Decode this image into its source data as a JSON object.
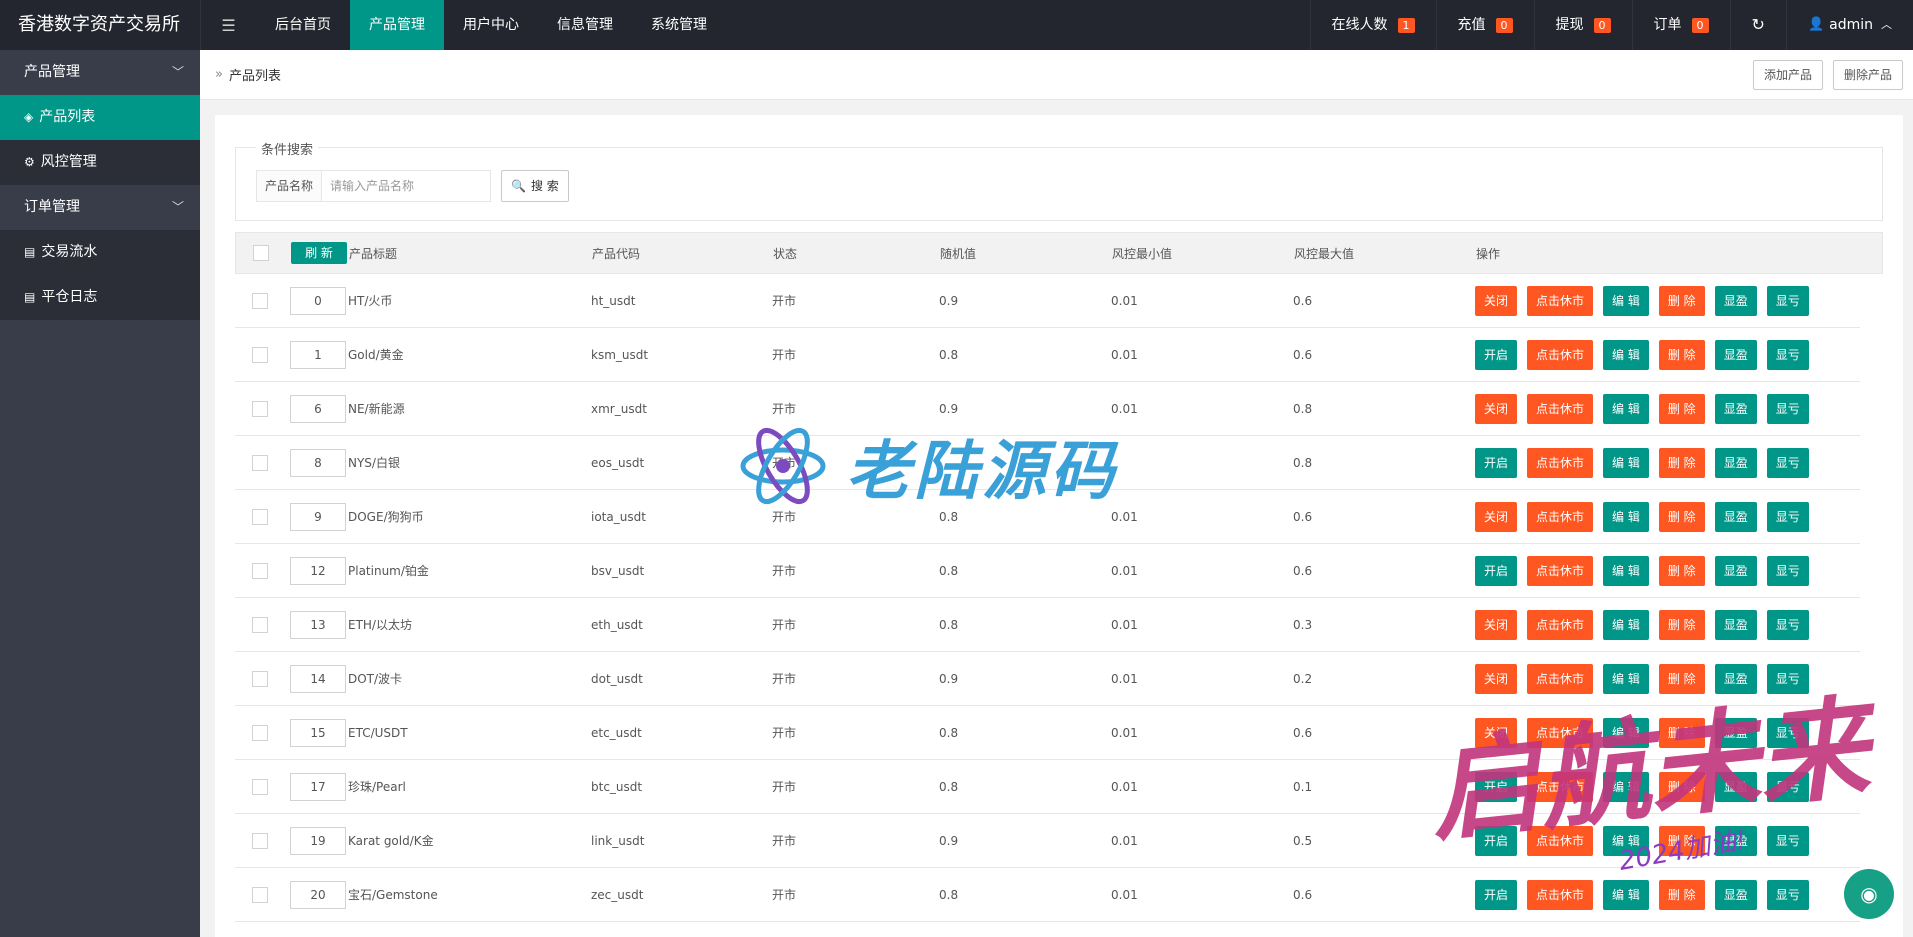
{
  "app": {
    "title": "香港数字资产交易所",
    "menu_toggle_icon": "hamburger-icon"
  },
  "nav": {
    "items": [
      {
        "label": "后台首页",
        "active": false
      },
      {
        "label": "产品管理",
        "active": true
      },
      {
        "label": "用户中心",
        "active": false
      },
      {
        "label": "信息管理",
        "active": false
      },
      {
        "label": "系统管理",
        "active": false
      }
    ]
  },
  "header_right": {
    "online_label": "在线人数",
    "online_count": "1",
    "recharge_label": "充值",
    "recharge_count": "0",
    "withdraw_label": "提现",
    "withdraw_count": "0",
    "order_label": "订单",
    "order_count": "0",
    "user_name": "admin"
  },
  "sidebar": {
    "group1": "产品管理",
    "item1": "产品列表",
    "item2": "风控管理",
    "group2": "订单管理",
    "item3": "交易流水",
    "item4": "平仓日志"
  },
  "breadcrumb": {
    "current": "产品列表",
    "add_button": "添加产品",
    "delete_button": "删除产品"
  },
  "search": {
    "legend": "条件搜索",
    "label": "产品名称",
    "placeholder": "请输入产品名称",
    "button": "搜 索"
  },
  "table": {
    "refresh_label": "刷 新",
    "headers": {
      "title": "产品标题",
      "code": "产品代码",
      "status": "状态",
      "random": "随机值",
      "risk_min": "风控最小值",
      "risk_max": "风控最大值",
      "ops": "操作"
    },
    "op_labels": {
      "close": "关闭",
      "open": "开启",
      "holiday": "点击休市",
      "edit": "编 辑",
      "delete": "删 除",
      "show_profit": "显盈",
      "show_loss": "显亏"
    },
    "rows": [
      {
        "sort": "0",
        "title": "HT/火币",
        "code": "ht_usdt",
        "status": "开市",
        "random": "0.9",
        "min": "0.01",
        "max": "0.6",
        "toggle": "关闭",
        "toggle_color": "red"
      },
      {
        "sort": "1",
        "title": "Gold/黄金",
        "code": "ksm_usdt",
        "status": "开市",
        "random": "0.8",
        "min": "0.01",
        "max": "0.6",
        "toggle": "开启",
        "toggle_color": "green"
      },
      {
        "sort": "6",
        "title": "NE/新能源",
        "code": "xmr_usdt",
        "status": "开市",
        "random": "0.9",
        "min": "0.01",
        "max": "0.8",
        "toggle": "关闭",
        "toggle_color": "red"
      },
      {
        "sort": "8",
        "title": "NYS/白银",
        "code": "eos_usdt",
        "status": "开市",
        "random": "",
        "min": "",
        "max": "0.8",
        "toggle": "开启",
        "toggle_color": "green"
      },
      {
        "sort": "9",
        "title": "DOGE/狗狗币",
        "code": "iota_usdt",
        "status": "开市",
        "random": "0.8",
        "min": "0.01",
        "max": "0.6",
        "toggle": "关闭",
        "toggle_color": "red"
      },
      {
        "sort": "12",
        "title": "Platinum/铂金",
        "code": "bsv_usdt",
        "status": "开市",
        "random": "0.8",
        "min": "0.01",
        "max": "0.6",
        "toggle": "开启",
        "toggle_color": "green"
      },
      {
        "sort": "13",
        "title": "ETH/以太坊",
        "code": "eth_usdt",
        "status": "开市",
        "random": "0.8",
        "min": "0.01",
        "max": "0.3",
        "toggle": "关闭",
        "toggle_color": "red"
      },
      {
        "sort": "14",
        "title": "DOT/波卡",
        "code": "dot_usdt",
        "status": "开市",
        "random": "0.9",
        "min": "0.01",
        "max": "0.2",
        "toggle": "关闭",
        "toggle_color": "red"
      },
      {
        "sort": "15",
        "title": "ETC/USDT",
        "code": "etc_usdt",
        "status": "开市",
        "random": "0.8",
        "min": "0.01",
        "max": "0.6",
        "toggle": "关闭",
        "toggle_color": "red"
      },
      {
        "sort": "17",
        "title": "珍珠/Pearl",
        "code": "btc_usdt",
        "status": "开市",
        "random": "0.8",
        "min": "0.01",
        "max": "0.1",
        "toggle": "开启",
        "toggle_color": "green"
      },
      {
        "sort": "19",
        "title": "Karat gold/K金",
        "code": "link_usdt",
        "status": "开市",
        "random": "0.9",
        "min": "0.01",
        "max": "0.5",
        "toggle": "开启",
        "toggle_color": "green"
      },
      {
        "sort": "20",
        "title": "宝石/Gemstone",
        "code": "zec_usdt",
        "status": "开市",
        "random": "0.8",
        "min": "0.01",
        "max": "0.6",
        "toggle": "开启",
        "toggle_color": "green"
      }
    ]
  },
  "watermarks": {
    "center": "老陆源码",
    "corner": "启航未来",
    "corner_sub": "2024加油!"
  },
  "colors": {
    "accent": "#009688",
    "danger": "#ff5722",
    "header_bg": "#23262e",
    "sidebar_bg": "#393d49"
  }
}
